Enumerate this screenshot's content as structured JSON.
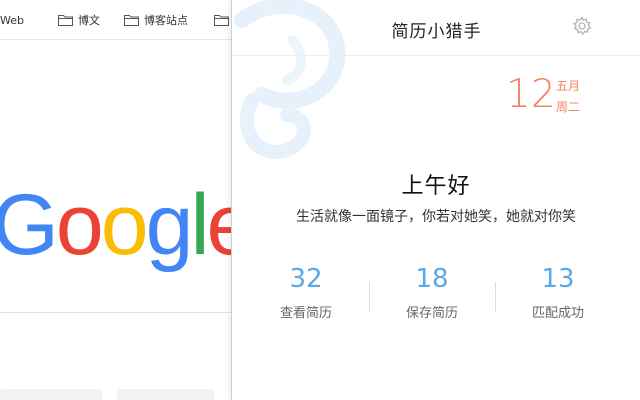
{
  "browser": {
    "bookmarks": [
      {
        "label": "Web",
        "icon": "folder-icon"
      },
      {
        "label": "博文",
        "icon": "folder-icon"
      },
      {
        "label": "博客站点",
        "icon": "folder-icon"
      },
      {
        "label": "",
        "icon": "folder-icon"
      }
    ],
    "logo": {
      "letters": [
        "G",
        "o",
        "o",
        "g",
        "l",
        "e"
      ],
      "colors": [
        "#4285F4",
        "#EA4335",
        "#FBBC05",
        "#4285F4",
        "#34A853",
        "#EA4335"
      ]
    }
  },
  "popup": {
    "title": "简历小猎手",
    "settings_icon": "gear-icon",
    "date": {
      "day": "12",
      "month": "五月",
      "weekday": "周二"
    },
    "greeting": "上午好",
    "motto": "生活就像一面镜子，你若对她笑，她就对你笑",
    "stats": [
      {
        "value": "32",
        "label": "查看简历"
      },
      {
        "value": "18",
        "label": "保存简历"
      },
      {
        "value": "13",
        "label": "匹配成功"
      }
    ],
    "colors": {
      "accent_orange": "#F4845F",
      "accent_blue": "#5AA9E6"
    }
  }
}
